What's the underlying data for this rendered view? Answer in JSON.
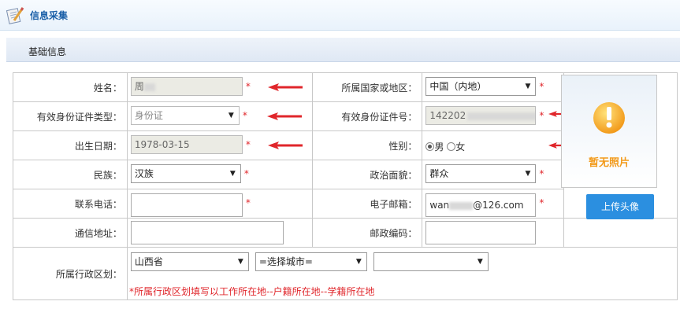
{
  "header": {
    "title": "信息采集",
    "icon": "document-pencil-icon"
  },
  "section": {
    "title": "基础信息"
  },
  "form": {
    "name_label": "姓名：",
    "name_value": "周",
    "country_label": "所属国家或地区：",
    "country_value": "中国（内地）",
    "idtype_label": "有效身份证件类型：",
    "idtype_value": "身份证",
    "idno_label": "有效身份证件号：",
    "idno_value": "142202",
    "birth_label": "出生日期：",
    "birth_value": "1978-03-15",
    "gender_label": "性别：",
    "gender_male": "男",
    "gender_female": "女",
    "nation_label": "民族：",
    "nation_value": "汉族",
    "political_label": "政治面貌：",
    "political_value": "群众",
    "phone_label": "联系电话：",
    "phone_value": "",
    "email_label": "电子邮箱：",
    "email_prefix": "wan",
    "email_suffix": "@126.com",
    "address_label": "通信地址：",
    "address_value": "",
    "postcode_label": "邮政编码：",
    "postcode_value": "",
    "region_label": "所属行政区划：",
    "province_value": "山西省",
    "city_value": "=选择城市=",
    "district_value": "",
    "region_note": "*所属行政区划填写以工作所在地--户籍所在地--学籍所在地"
  },
  "required_mark": "*",
  "photo": {
    "caption": "暂无照片",
    "icon": "exclamation-icon"
  },
  "upload_button": "上传头像",
  "colors": {
    "required": "#e0262b",
    "accent": "#2b8fe0",
    "photo_caption": "#f29a1b"
  }
}
